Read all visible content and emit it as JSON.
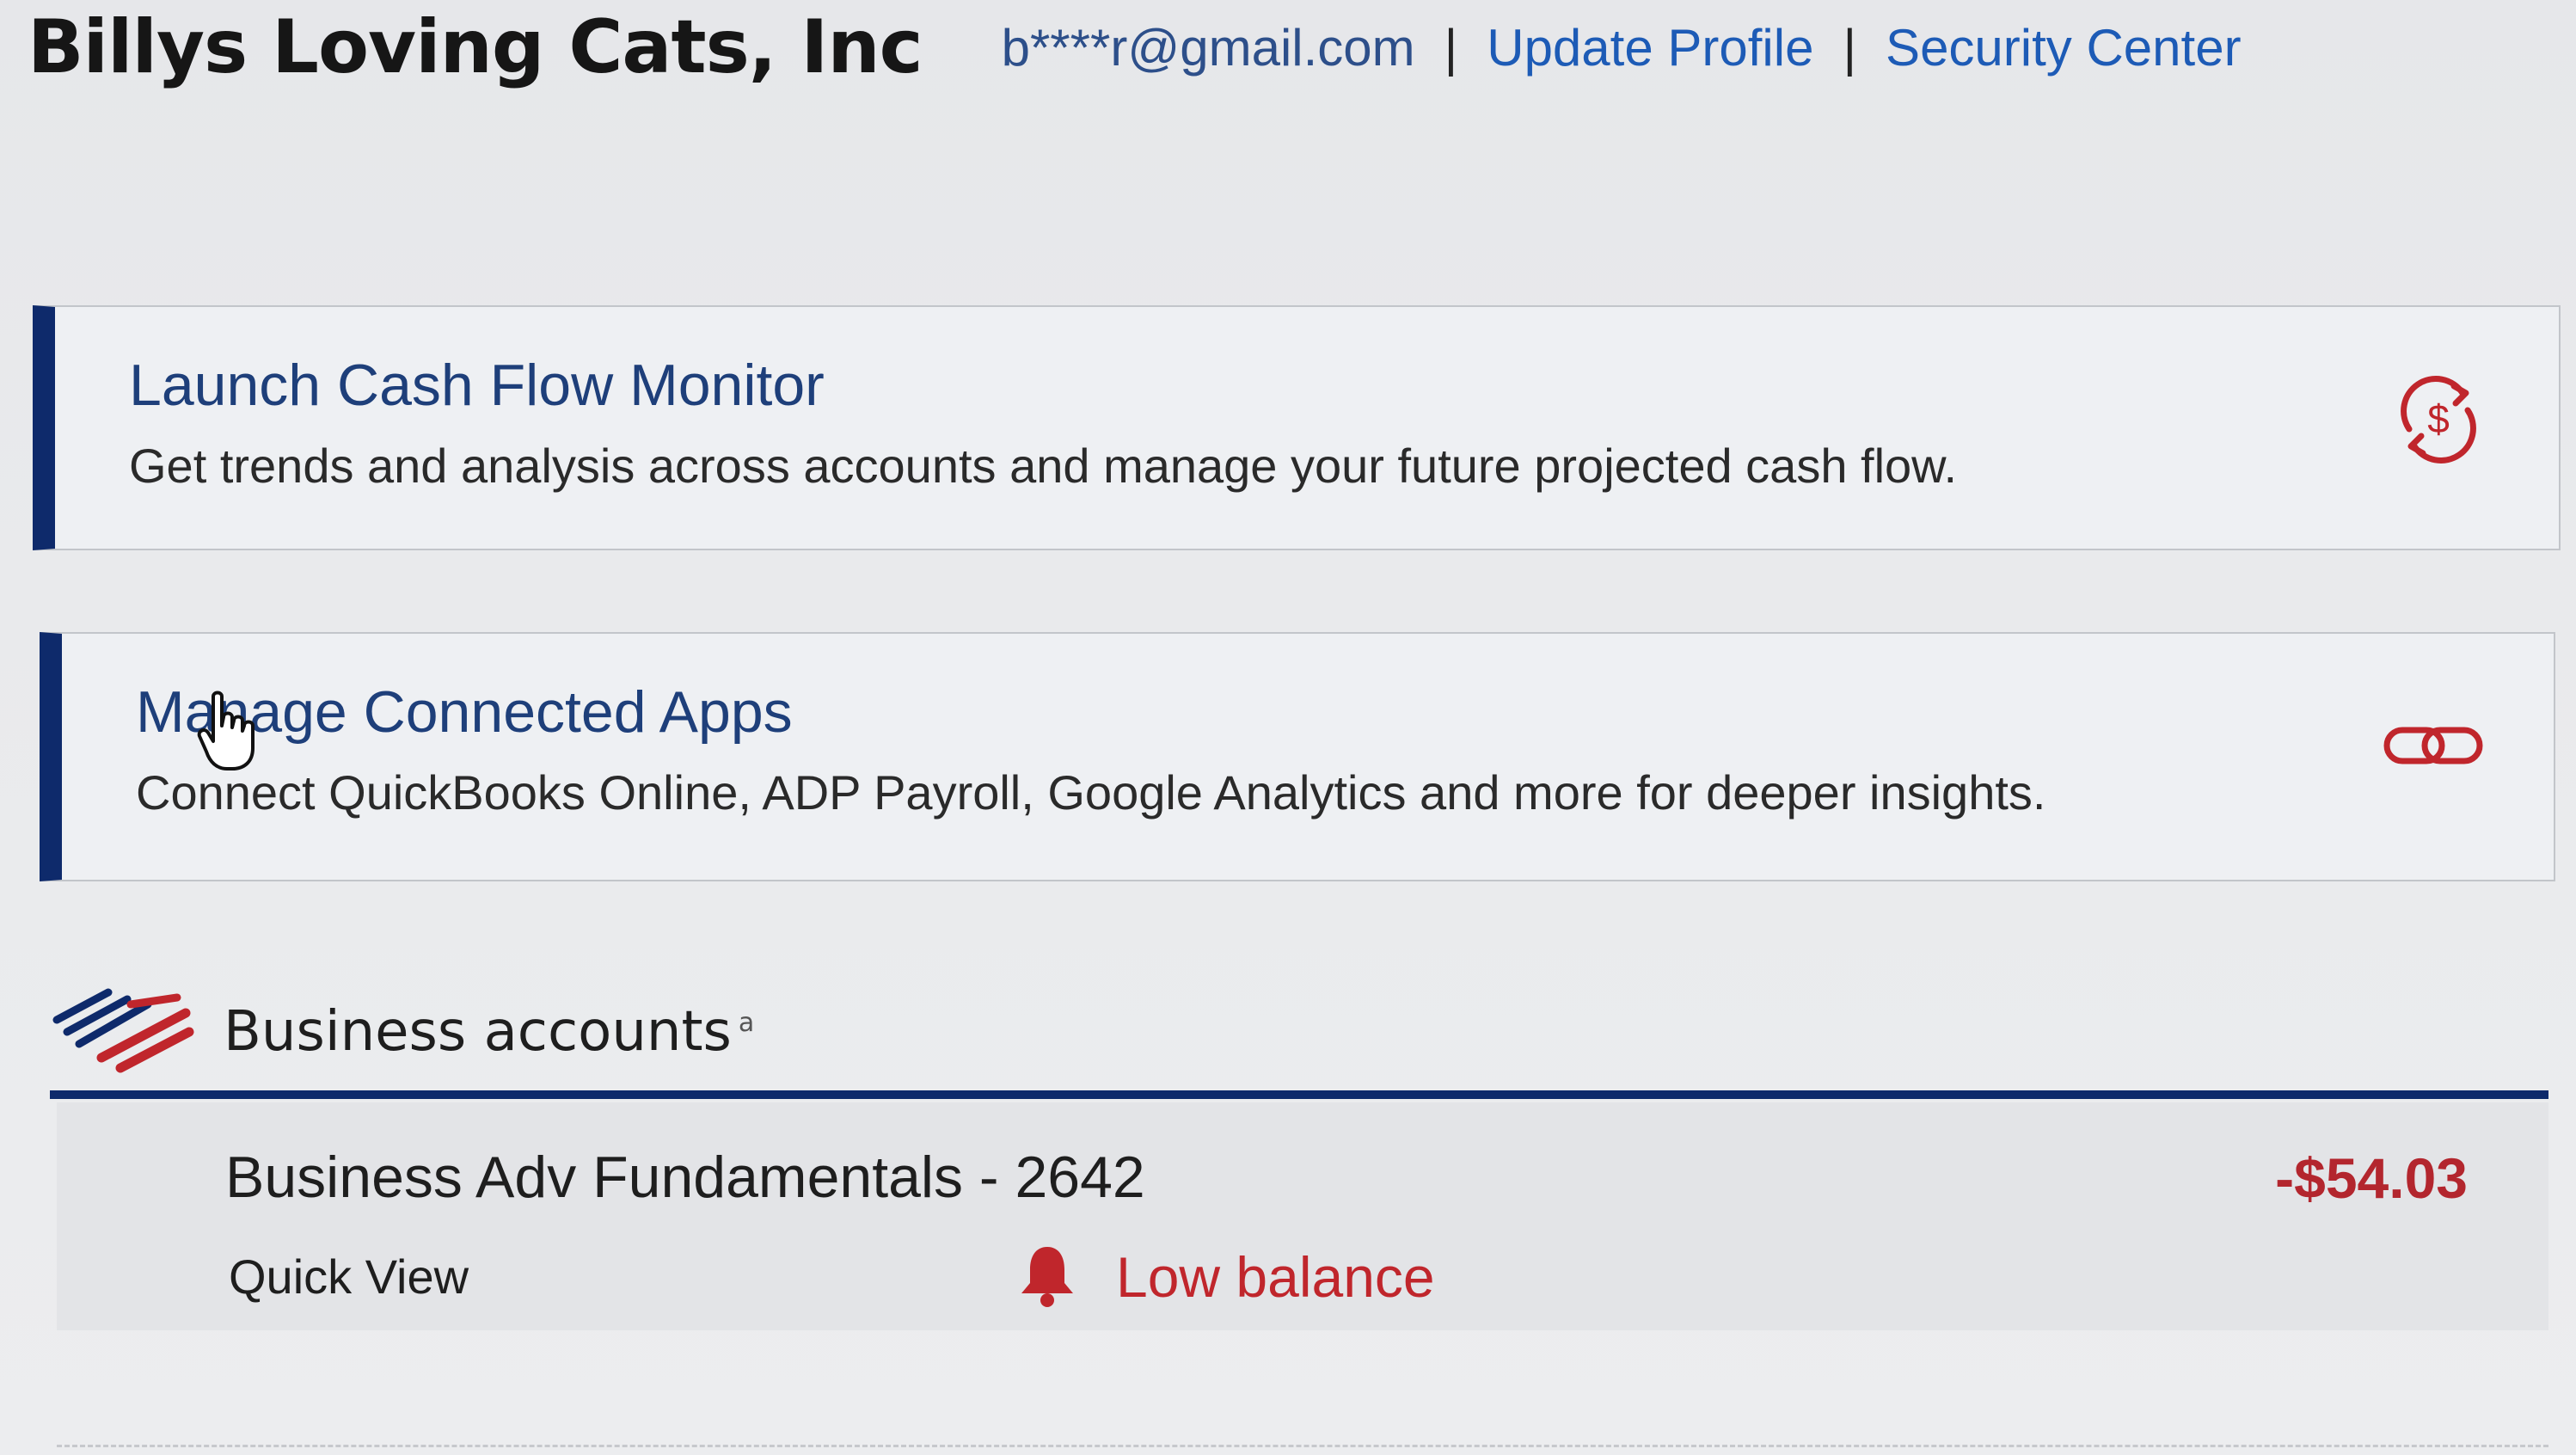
{
  "header": {
    "company_name": "Billys Loving Cats, Inc",
    "email": "b****r@gmail.com",
    "separator": "|",
    "links": [
      {
        "label": "Update Profile"
      },
      {
        "label": "Security Center"
      }
    ]
  },
  "cards": [
    {
      "title": "Launch Cash Flow Monitor",
      "description": "Get trends and analysis across accounts and manage your future projected cash flow.",
      "icon": "cash-flow-icon"
    },
    {
      "title": "Manage Connected Apps",
      "description": "Connect QuickBooks Online, ADP Payroll, Google Analytics and more for deeper insights.",
      "icon": "link-icon"
    }
  ],
  "business_accounts": {
    "title": "Business accounts",
    "superscript": "a",
    "logo": "flagscape-logo",
    "accounts": [
      {
        "name": "Business Adv Fundamentals - 2642",
        "balance": "-$54.03",
        "quick_view_label": "Quick View",
        "alert": "Low balance",
        "alert_icon": "bell-icon"
      }
    ]
  },
  "colors": {
    "brand_navy": "#0e2a6b",
    "link_blue": "#1d5bb6",
    "alert_red": "#c0262c",
    "balance_red": "#b3262e"
  }
}
